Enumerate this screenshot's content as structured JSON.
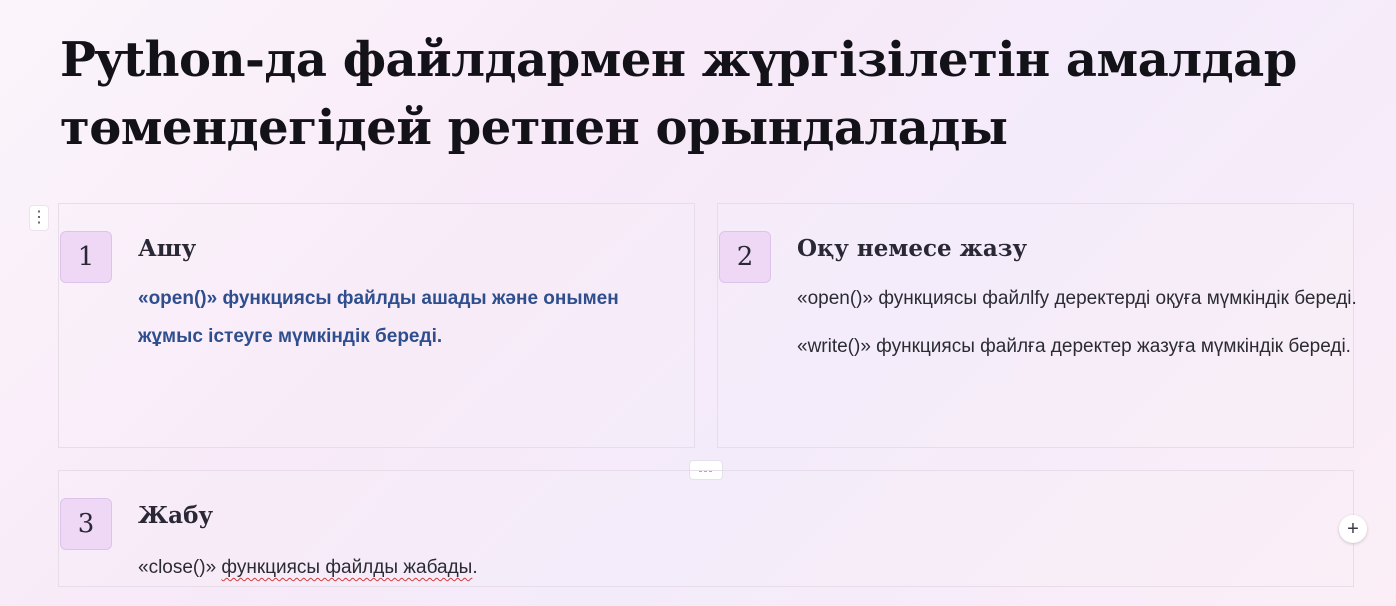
{
  "title": "Python-да файлдармен жүргізілетін амалдар төмендегідей ретпен орындалады",
  "steps": [
    {
      "number": "1",
      "title": "Ашу",
      "paragraphs": [
        "«open()» функциясы файлды ашады және онымен жұмыс істеуге мүмкіндік береді."
      ]
    },
    {
      "number": "2",
      "title": "Оқу немесе жазу",
      "paragraphs": [
        "«open()» функциясы файлlfy деректерді  оқуға мүмкіндік береді.",
        "«write()» функциясы файлға деректер жазуға мүмкіндік береді."
      ]
    },
    {
      "number": "3",
      "title": "Жабу",
      "body_prefix": "«close()» ",
      "body_misspelled": "функциясы файлды жабады",
      "body_suffix": "."
    }
  ],
  "controls": {
    "drag_handle_icon": "⋮",
    "divider_handle_label": "---",
    "add_icon": "+"
  }
}
